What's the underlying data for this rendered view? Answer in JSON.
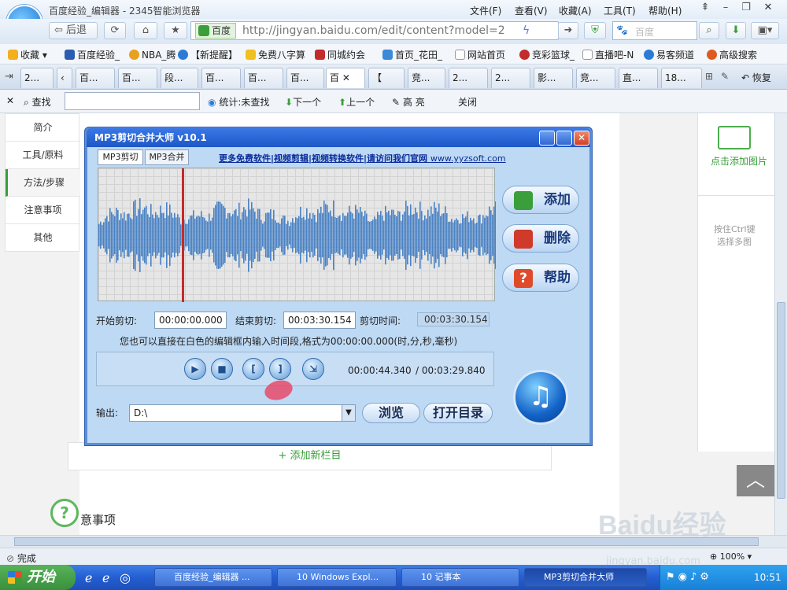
{
  "browser": {
    "window_title": "百度经验_编辑器 - 2345智能浏览器",
    "menus": [
      "文件(F)",
      "查看(V)",
      "收藏(A)",
      "工具(T)",
      "帮助(H)"
    ],
    "back_label": "后退",
    "url_badge": "百度",
    "url": "http://jingyan.baidu.com/edit/content?model=2",
    "search_placeholder": "百度",
    "favorites": [
      "收藏",
      "百度经验_",
      "NBA_腾",
      "【新提醒】",
      "免费八字算",
      "同城约会",
      "首页_花田_",
      "网站首页",
      "竞彩篮球_",
      "直播吧-N",
      "易客频道",
      "高级搜索"
    ],
    "tabs": [
      "2...",
      "百...",
      "百...",
      "段...",
      "百...",
      "百...",
      "百...",
      "百",
      "【",
      "竞...",
      "2...",
      "2...",
      "影...",
      "竞...",
      "直...",
      "18..."
    ],
    "restore_label": "恢复"
  },
  "findbar": {
    "find_label": "查找",
    "stats_label": "统计:未查找",
    "next_label": "下一个",
    "prev_label": "上一个",
    "highlight_label": "高 亮",
    "close_label": "关闭"
  },
  "page": {
    "left_nav": [
      "简介",
      "工具/原料",
      "方法/步骤",
      "注意事项",
      "其他"
    ],
    "add_section_label": "+ 添加新栏目",
    "right_add_image": "点击添加图片",
    "right_hint_1": "按住Ctrl键",
    "right_hint_2": "选择多图",
    "notes_heading": "意事项"
  },
  "dialog": {
    "title": "MP3剪切合并大师 v10.1",
    "tab_cut": "MP3剪切",
    "tab_merge": "MP3合并",
    "promo_link": "更多免费软件|视频剪辑|视频转换软件|请访问我们官网",
    "promo_site": "www.yyzsoft.com",
    "add_label": "添加",
    "delete_label": "删除",
    "help_label": "帮助",
    "start_cut_label": "开始剪切:",
    "start_cut_value": "00:00:00.000",
    "end_cut_label": "结束剪切:",
    "end_cut_value": "00:03:30.154",
    "cut_time_label": "剪切时间:",
    "cut_time_value": "00:03:30.154",
    "hint": "您也可以直接在白色的编辑框内输入时间段,格式为00:00:00.000(时,分,秒,毫秒)",
    "current_time": "00:00:44.340",
    "total_time": "/ 00:03:29.840",
    "output_label": "输出:",
    "output_value": "D:\\",
    "browse_label": "浏览",
    "open_dir_label": "打开目录",
    "playhead_fraction": 0.212
  },
  "status": {
    "text": "完成",
    "zoom": "100%"
  },
  "taskbar": {
    "start_label": "开始",
    "tasks": [
      "百度经验_编辑器 ...",
      "10 Windows Expl...",
      "10 记事本",
      "MP3剪切合并大师"
    ],
    "clock": "10:51"
  },
  "watermark": "Baidu经验",
  "watermark_url": "jingyan.baidu.com"
}
